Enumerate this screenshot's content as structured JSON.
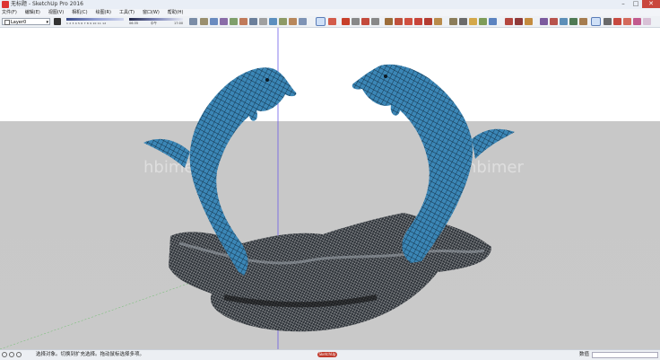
{
  "window": {
    "title": "无标题 - SketchUp Pro 2016"
  },
  "menu": {
    "items": [
      "文件(F)",
      "编辑(E)",
      "视图(V)",
      "相机(C)",
      "绘图(R)",
      "工具(T)",
      "窗口(W)",
      "帮助(H)"
    ]
  },
  "toolbar": {
    "layer_value": "Layer0",
    "shadow_scale": "1 2 3 4 5 6 7 8 9 10 11 12",
    "time_start": "06:35",
    "time_mid": "中午",
    "time_end": "17:00"
  },
  "status": {
    "message": "选择对象。切换到扩充选择。拖动鼠标选择多项。",
    "measure_label": "数值",
    "logo_text": "SketchUp"
  },
  "watermark": "hbimer",
  "colors": {
    "dolphin": "#3b86b6",
    "rock": "#3a3f46",
    "ground": "#c9c9c9",
    "sky": "#ffffff"
  },
  "icons": [
    "orbit-icon",
    "select-arrow-icon",
    "pencil-icon",
    "shapes-icon",
    "move-icon",
    "paint-icon"
  ]
}
